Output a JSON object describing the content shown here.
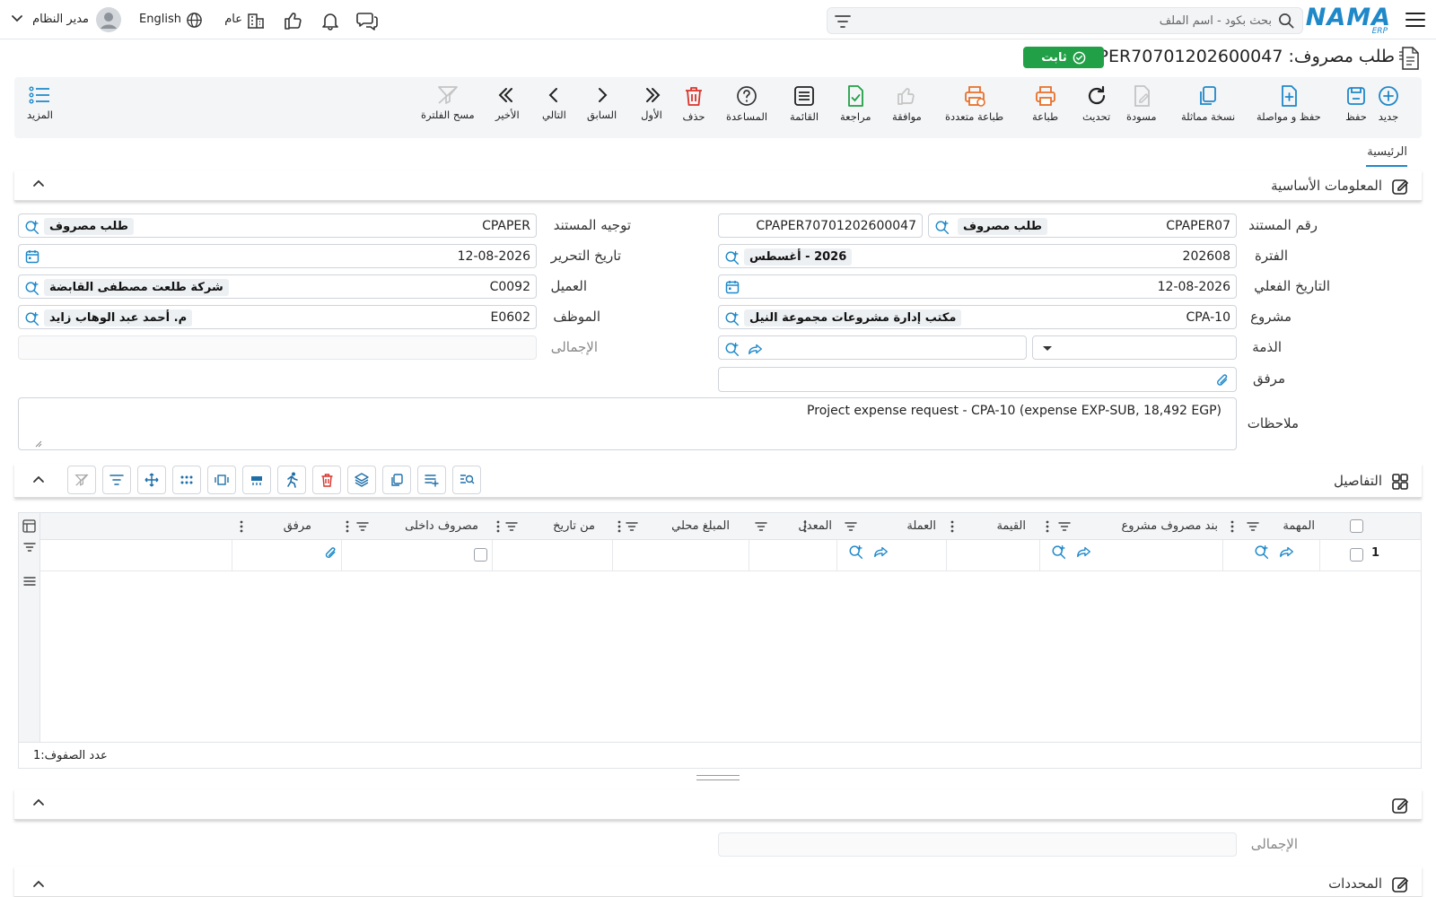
{
  "topbar": {
    "brand": "NAMA",
    "brand_sub": "ERP",
    "search_placeholder": "بحث بكود - اسم الملف",
    "user_name": "مدير النظام",
    "language": "English",
    "branch": "عام",
    "icons": [
      "menu-icon",
      "search-icon",
      "filter-icon",
      "chat-icon",
      "bell-icon",
      "thumbs-up-icon",
      "building-icon",
      "globe-icon",
      "user-avatar-icon",
      "chevron-down-icon"
    ]
  },
  "doc": {
    "title_prefix": "طلب مصروف:",
    "code": "CPAPER70701202600047",
    "status": "ثابت"
  },
  "toolbar": {
    "items": [
      {
        "key": "new",
        "label": "جديد",
        "icon": "plus-circle-icon",
        "color": "#1e88c9"
      },
      {
        "key": "save",
        "label": "حفظ",
        "icon": "save-icon",
        "color": "#1e88c9"
      },
      {
        "key": "save_continue",
        "label": "حفظ و مواصلة",
        "icon": "file-plus-icon",
        "color": "#1e88c9"
      },
      {
        "key": "duplicate",
        "label": "نسخة مماثلة",
        "icon": "copy-icon",
        "color": "#1e88c9"
      },
      {
        "key": "draft",
        "label": "مسودة",
        "icon": "pen-off-icon",
        "color": "#bbbbbb"
      },
      {
        "key": "refresh",
        "label": "تحديث",
        "icon": "refresh-icon",
        "color": "#222222"
      },
      {
        "key": "print",
        "label": "طباعة",
        "icon": "printer-icon",
        "color": "#e8702a"
      },
      {
        "key": "multi_print",
        "label": "طباعة متعددة",
        "icon": "printer-multi-icon",
        "color": "#e8702a"
      },
      {
        "key": "approve",
        "label": "موافقة",
        "icon": "thumbs-up-icon",
        "color": "#bbbbbb"
      },
      {
        "key": "review",
        "label": "مراجعة",
        "icon": "file-check-icon",
        "color": "#22a047"
      },
      {
        "key": "list",
        "label": "القائمة",
        "icon": "list-icon",
        "color": "#222222"
      },
      {
        "key": "help",
        "label": "المساعدة",
        "icon": "help-icon",
        "color": "#333333"
      },
      {
        "key": "delete",
        "label": "حذف",
        "icon": "trash-icon",
        "color": "#d9342b"
      },
      {
        "key": "first",
        "label": "الأول",
        "icon": "chevrons-right-icon",
        "color": "#222222"
      },
      {
        "key": "prev",
        "label": "السابق",
        "icon": "chevron-right-icon",
        "color": "#222222"
      },
      {
        "key": "next",
        "label": "التالي",
        "icon": "chevron-left-icon",
        "color": "#222222"
      },
      {
        "key": "last",
        "label": "الأخير",
        "icon": "chevrons-left-icon",
        "color": "#222222"
      },
      {
        "key": "clear_filter",
        "label": "مسح الفلترة",
        "icon": "filter-off-icon",
        "color": "#bbbbbb"
      }
    ],
    "more_label": "المزيد"
  },
  "tabs": {
    "main": "الرئيسية"
  },
  "basic": {
    "section_title": "المعلومات الأساسية",
    "doc_number": {
      "label": "رقم المستند",
      "prefix": "CPAPER07",
      "type": "طلب مصروف",
      "full": "CPAPER70701202600047"
    },
    "doc_direction": {
      "label": "توجيه المستند",
      "code": "CPAPER",
      "name": "طلب مصروف"
    },
    "period": {
      "label": "الفترة",
      "code": "202608",
      "name": "2026 - أغسطس"
    },
    "edit_date": {
      "label": "تاريخ التحرير",
      "value": "12-08-2026"
    },
    "actual_date": {
      "label": "التاريخ الفعلي",
      "value": "12-08-2026"
    },
    "customer": {
      "label": "العميل",
      "code": "C0092",
      "name": "شركة طلعت مصطفى القابضة"
    },
    "project": {
      "label": "مشروع",
      "code": "CPA-10",
      "name": "مكتب إدارة مشروعات مجموعة النيل"
    },
    "employee": {
      "label": "الموظف",
      "code": "E0602",
      "name": "م. أحمد عبد الوهاب زايد"
    },
    "liability": {
      "label": "الذمة",
      "value": ""
    },
    "total": {
      "label": "الإجمالى",
      "value": ""
    },
    "attachment": {
      "label": "مرفق",
      "value": ""
    },
    "notes": {
      "label": "ملاحظات",
      "value": "Project expense request - CPA-10 (expense EXP-SUB, 18,492 EGP)"
    }
  },
  "details": {
    "section_title": "التفاصيل",
    "tools": [
      "search-list-icon",
      "list-plus-icon",
      "copy-icon",
      "layers-icon",
      "trash-icon",
      "run-icon",
      "table-insert-icon",
      "frame-icon",
      "grid-dots-icon",
      "move-icon",
      "filter-lines-icon",
      "filter-off-icon"
    ],
    "columns": [
      "المهمة",
      "بند مصروف مشروع",
      "القيمة",
      "العملة",
      "المعدل",
      "المبلغ محلي",
      "من تاريخ",
      "مصروف داخلى",
      "مرفق"
    ],
    "rows": [
      {
        "num": "1"
      }
    ],
    "row_count_label": "عدد الصفوف:",
    "row_count": "1"
  },
  "summary": {
    "total_label": "الإجمالى",
    "total_value": ""
  },
  "selectors": {
    "section_title": "المحددات"
  }
}
